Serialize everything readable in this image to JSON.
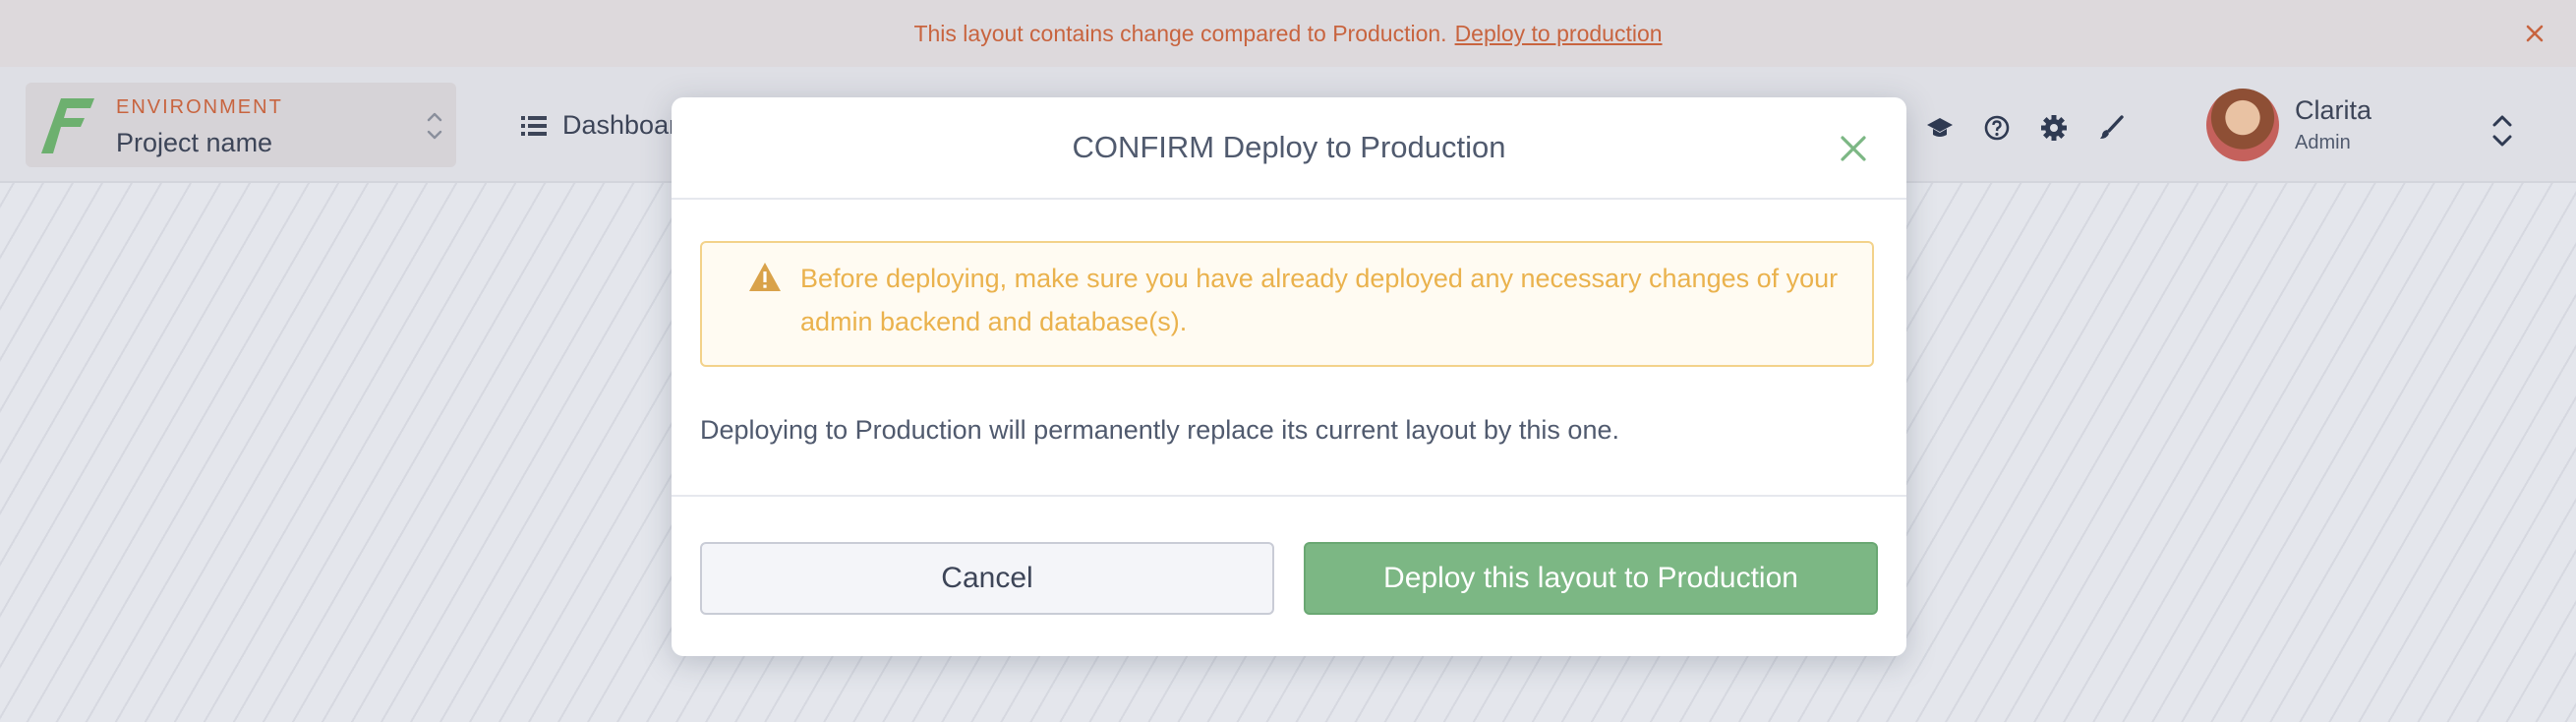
{
  "banner": {
    "message": "This layout contains change compared to Production.",
    "link": "Deploy to production"
  },
  "topbar": {
    "environment_label": "ENVIRONMENT",
    "project_name": "Project name",
    "nav_label": "Dashboard",
    "user": {
      "name": "Clarita",
      "role": "Admin"
    }
  },
  "modal": {
    "title": "CONFIRM Deploy to Production",
    "warning": "Before deploying, make sure you have already deployed any necessary changes of your admin backend and database(s).",
    "message": "Deploying to Production will permanently replace its current layout by this one.",
    "cancel_label": "Cancel",
    "confirm_label": "Deploy this layout to Production"
  },
  "colors": {
    "accent_green": "#7cb784",
    "warning": "#eab24d",
    "banner_text": "#c8643f"
  }
}
